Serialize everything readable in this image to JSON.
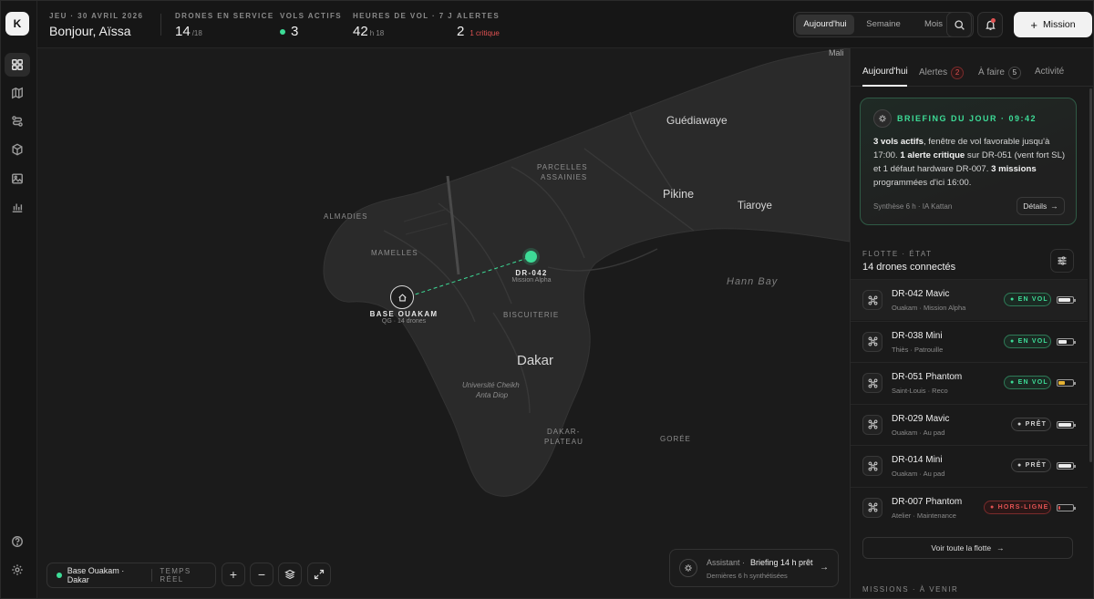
{
  "rail": {
    "logo": "K",
    "items": [
      "dashboard-icon",
      "map-icon",
      "routes-icon",
      "cube-icon",
      "image-icon",
      "chart-icon"
    ],
    "bottom": [
      "help-icon",
      "settings-icon"
    ]
  },
  "header": {
    "date": "JEU · 30 AVRIL 2026",
    "greeting": "Bonjour, Aïssa",
    "drones_label": "DRONES EN SERVICE",
    "drones_value": "14",
    "drones_total": "/18",
    "active_label": "VOLS ACTIFS",
    "active_value": "3",
    "hours_label": "HEURES DE VOL · 7 J",
    "hours_value": "42",
    "hours_unit": "h 18",
    "alerts_label": "ALERTES",
    "alerts_value": "2",
    "alerts_note": "1 critique",
    "periods": [
      "Aujourd'hui",
      "Semaine",
      "Mois"
    ],
    "period_selected": "Aujourd'hui",
    "mission_button": "Mission"
  },
  "map": {
    "labels": {
      "mali": "Mali",
      "guediawaye": "Guédiawaye",
      "parcelles": "PARCELLES",
      "assainies": "ASSAINIES",
      "pikine": "Pikine",
      "tiaroye": "Tiaroye",
      "almadies": "ALMADIES",
      "mamelles": "MAMELLES",
      "hann_bay": "Hann Bay",
      "biscuiterie": "BISCUITERIE",
      "dakar": "Dakar",
      "universite1": "Université Cheikh",
      "universite2": "Anta Diop",
      "plateau1": "DAKAR-",
      "plateau2": "PLATEAU",
      "goree": "GORÉE"
    },
    "drone_pin": {
      "title": "DR-042",
      "subtitle": "Mission Alpha"
    },
    "base_pin": {
      "title": "BASE OUAKAM",
      "subtitle": "QG · 14 drones"
    },
    "live": {
      "location": "Base Ouakam · Dakar",
      "mode": "TEMPS RÉEL"
    },
    "controls": {
      "zoom_in": "+",
      "zoom_out": "−"
    },
    "assistant": {
      "label": "Assistant ·",
      "title": "Briefing 14 h prêt",
      "subtitle": "Dernières 6 h synthétisées",
      "arrow": "→"
    }
  },
  "panel": {
    "tabs": [
      {
        "label": "Aujourd'hui",
        "badge": ""
      },
      {
        "label": "Alertes",
        "badge": "2"
      },
      {
        "label": "À faire",
        "badge": "5"
      },
      {
        "label": "Activité",
        "badge": ""
      }
    ],
    "briefing": {
      "title": "BRIEFING DU JOUR · 09:42",
      "b1": "3 vols actifs",
      "t1": ", fenêtre de vol favorable jusqu'à 17:00. ",
      "b2": "1 alerte critique",
      "t2": " sur DR-051 (vent fort SL) et 1 défaut hardware DR-007. ",
      "b3": "3 missions",
      "t3": " programmées d'ici 16:00.",
      "footer": "Synthèse 6 h · IA Kattan",
      "details": "Détails",
      "details_arrow": "→"
    },
    "fleet": {
      "label": "FLOTTE · ÉTAT",
      "count": "14 drones connectés",
      "drones": [
        {
          "name": "DR-042 Mavic",
          "sub": "Ouakam · Mission Alpha",
          "status": "EN VOL",
          "kind": "fly",
          "battery": 0.85,
          "battery_color": "#eeeeee"
        },
        {
          "name": "DR-038 Mini",
          "sub": "Thiès · Patrouille",
          "status": "EN VOL",
          "kind": "fly",
          "battery": 0.62,
          "battery_color": "#eeeeee"
        },
        {
          "name": "DR-051 Phantom",
          "sub": "Saint-Louis · Reco",
          "status": "EN VOL",
          "kind": "fly",
          "battery": 0.45,
          "battery_color": "#e6b333"
        },
        {
          "name": "DR-029 Mavic",
          "sub": "Ouakam · Au pad",
          "status": "PRÊT",
          "kind": "ready",
          "battery": 0.95,
          "battery_color": "#eeeeee"
        },
        {
          "name": "DR-014 Mini",
          "sub": "Ouakam · Au pad",
          "status": "PRÊT",
          "kind": "ready",
          "battery": 0.9,
          "battery_color": "#eeeeee"
        },
        {
          "name": "DR-007 Phantom",
          "sub": "Atelier · Maintenance",
          "status": "HORS-LIGNE",
          "kind": "off",
          "battery": 0.1,
          "battery_color": "#e05252"
        }
      ],
      "see_all": "Voir toute la flotte",
      "see_all_arrow": "→"
    },
    "missions_label": "MISSIONS · À VENIR"
  }
}
